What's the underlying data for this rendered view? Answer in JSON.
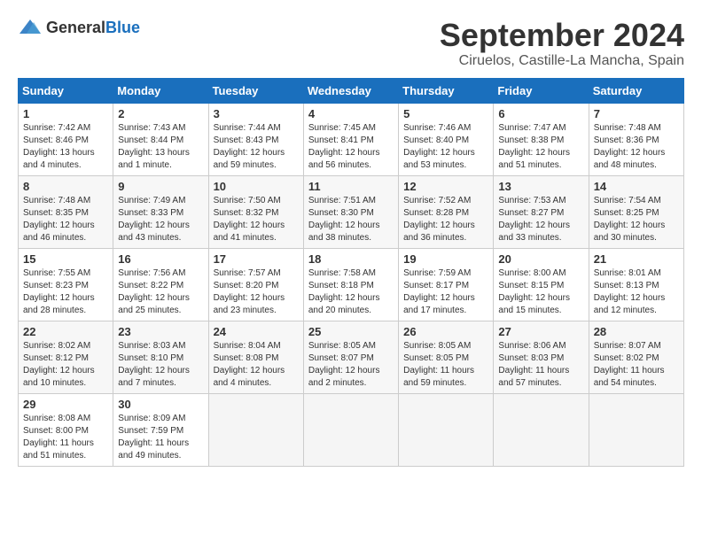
{
  "logo": {
    "general": "General",
    "blue": "Blue"
  },
  "title": "September 2024",
  "location": "Ciruelos, Castille-La Mancha, Spain",
  "headers": [
    "Sunday",
    "Monday",
    "Tuesday",
    "Wednesday",
    "Thursday",
    "Friday",
    "Saturday"
  ],
  "weeks": [
    [
      {
        "day": "1",
        "sunrise": "7:42 AM",
        "sunset": "8:46 PM",
        "daylight": "13 hours and 4 minutes."
      },
      {
        "day": "2",
        "sunrise": "7:43 AM",
        "sunset": "8:44 PM",
        "daylight": "13 hours and 1 minute."
      },
      {
        "day": "3",
        "sunrise": "7:44 AM",
        "sunset": "8:43 PM",
        "daylight": "12 hours and 59 minutes."
      },
      {
        "day": "4",
        "sunrise": "7:45 AM",
        "sunset": "8:41 PM",
        "daylight": "12 hours and 56 minutes."
      },
      {
        "day": "5",
        "sunrise": "7:46 AM",
        "sunset": "8:40 PM",
        "daylight": "12 hours and 53 minutes."
      },
      {
        "day": "6",
        "sunrise": "7:47 AM",
        "sunset": "8:38 PM",
        "daylight": "12 hours and 51 minutes."
      },
      {
        "day": "7",
        "sunrise": "7:48 AM",
        "sunset": "8:36 PM",
        "daylight": "12 hours and 48 minutes."
      }
    ],
    [
      {
        "day": "8",
        "sunrise": "7:48 AM",
        "sunset": "8:35 PM",
        "daylight": "12 hours and 46 minutes."
      },
      {
        "day": "9",
        "sunrise": "7:49 AM",
        "sunset": "8:33 PM",
        "daylight": "12 hours and 43 minutes."
      },
      {
        "day": "10",
        "sunrise": "7:50 AM",
        "sunset": "8:32 PM",
        "daylight": "12 hours and 41 minutes."
      },
      {
        "day": "11",
        "sunrise": "7:51 AM",
        "sunset": "8:30 PM",
        "daylight": "12 hours and 38 minutes."
      },
      {
        "day": "12",
        "sunrise": "7:52 AM",
        "sunset": "8:28 PM",
        "daylight": "12 hours and 36 minutes."
      },
      {
        "day": "13",
        "sunrise": "7:53 AM",
        "sunset": "8:27 PM",
        "daylight": "12 hours and 33 minutes."
      },
      {
        "day": "14",
        "sunrise": "7:54 AM",
        "sunset": "8:25 PM",
        "daylight": "12 hours and 30 minutes."
      }
    ],
    [
      {
        "day": "15",
        "sunrise": "7:55 AM",
        "sunset": "8:23 PM",
        "daylight": "12 hours and 28 minutes."
      },
      {
        "day": "16",
        "sunrise": "7:56 AM",
        "sunset": "8:22 PM",
        "daylight": "12 hours and 25 minutes."
      },
      {
        "day": "17",
        "sunrise": "7:57 AM",
        "sunset": "8:20 PM",
        "daylight": "12 hours and 23 minutes."
      },
      {
        "day": "18",
        "sunrise": "7:58 AM",
        "sunset": "8:18 PM",
        "daylight": "12 hours and 20 minutes."
      },
      {
        "day": "19",
        "sunrise": "7:59 AM",
        "sunset": "8:17 PM",
        "daylight": "12 hours and 17 minutes."
      },
      {
        "day": "20",
        "sunrise": "8:00 AM",
        "sunset": "8:15 PM",
        "daylight": "12 hours and 15 minutes."
      },
      {
        "day": "21",
        "sunrise": "8:01 AM",
        "sunset": "8:13 PM",
        "daylight": "12 hours and 12 minutes."
      }
    ],
    [
      {
        "day": "22",
        "sunrise": "8:02 AM",
        "sunset": "8:12 PM",
        "daylight": "12 hours and 10 minutes."
      },
      {
        "day": "23",
        "sunrise": "8:03 AM",
        "sunset": "8:10 PM",
        "daylight": "12 hours and 7 minutes."
      },
      {
        "day": "24",
        "sunrise": "8:04 AM",
        "sunset": "8:08 PM",
        "daylight": "12 hours and 4 minutes."
      },
      {
        "day": "25",
        "sunrise": "8:05 AM",
        "sunset": "8:07 PM",
        "daylight": "12 hours and 2 minutes."
      },
      {
        "day": "26",
        "sunrise": "8:05 AM",
        "sunset": "8:05 PM",
        "daylight": "11 hours and 59 minutes."
      },
      {
        "day": "27",
        "sunrise": "8:06 AM",
        "sunset": "8:03 PM",
        "daylight": "11 hours and 57 minutes."
      },
      {
        "day": "28",
        "sunrise": "8:07 AM",
        "sunset": "8:02 PM",
        "daylight": "11 hours and 54 minutes."
      }
    ],
    [
      {
        "day": "29",
        "sunrise": "8:08 AM",
        "sunset": "8:00 PM",
        "daylight": "11 hours and 51 minutes."
      },
      {
        "day": "30",
        "sunrise": "8:09 AM",
        "sunset": "7:59 PM",
        "daylight": "11 hours and 49 minutes."
      },
      null,
      null,
      null,
      null,
      null
    ]
  ]
}
